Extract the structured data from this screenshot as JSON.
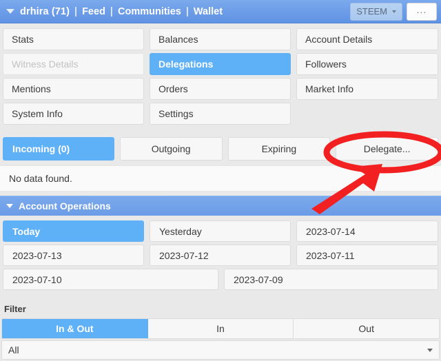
{
  "topnav": {
    "dropdown_icon": "triangle-down-icon",
    "username": "drhira (71)",
    "separator": "|",
    "links": [
      {
        "label": "Feed"
      },
      {
        "label": "Communities"
      },
      {
        "label": "Wallet"
      }
    ],
    "token_select": {
      "value": "STEEM",
      "caret_icon": "caret-down-icon"
    },
    "more_button": "...",
    "background_color": "#6d9de8"
  },
  "section_nav": {
    "rows": [
      [
        {
          "label": "Stats",
          "state": "default"
        },
        {
          "label": "Balances",
          "state": "default"
        },
        {
          "label": "Account Details",
          "state": "default"
        }
      ],
      [
        {
          "label": "Witness Details",
          "state": "disabled"
        },
        {
          "label": "Delegations",
          "state": "active"
        },
        {
          "label": "Followers",
          "state": "default"
        }
      ],
      [
        {
          "label": "Mentions",
          "state": "default"
        },
        {
          "label": "Orders",
          "state": "default"
        },
        {
          "label": "Market Info",
          "state": "default"
        }
      ],
      [
        {
          "label": "System Info",
          "state": "default"
        },
        {
          "label": "Settings",
          "state": "default"
        },
        {
          "label": "",
          "state": "empty"
        }
      ]
    ],
    "active_color": "#5fb1f7",
    "disabled_color": "#c2c2c2"
  },
  "delegation_tabs": [
    {
      "label": "Incoming (0)",
      "state": "active"
    },
    {
      "label": "Outgoing",
      "state": "default"
    },
    {
      "label": "Expiring",
      "state": "default"
    },
    {
      "label": "Delegate...",
      "state": "default"
    }
  ],
  "result_panel": {
    "message": "No data found."
  },
  "account_operations": {
    "title": "Account Operations",
    "collapse_icon": "triangle-down-icon",
    "bar_color": "#6d9de8"
  },
  "date_grid": {
    "rows": [
      [
        {
          "label": "Today",
          "state": "active"
        },
        {
          "label": "Yesterday",
          "state": "default"
        },
        {
          "label": "2023-07-14",
          "state": "default"
        }
      ],
      [
        {
          "label": "2023-07-13",
          "state": "default"
        },
        {
          "label": "2023-07-12",
          "state": "default"
        },
        {
          "label": "2023-07-11",
          "state": "default"
        }
      ],
      [
        {
          "label": "2023-07-10",
          "state": "default"
        },
        {
          "label": "2023-07-09",
          "state": "default"
        }
      ]
    ]
  },
  "filter": {
    "label": "Filter",
    "segments": [
      {
        "label": "In & Out",
        "state": "active"
      },
      {
        "label": "In",
        "state": "default"
      },
      {
        "label": "Out",
        "state": "default"
      }
    ],
    "type_select": {
      "value": "All",
      "caret_icon": "caret-down-icon"
    }
  },
  "annotation": {
    "shape": "red-ellipse-with-arrow",
    "color": "#f22020",
    "target": "Delegate..."
  }
}
